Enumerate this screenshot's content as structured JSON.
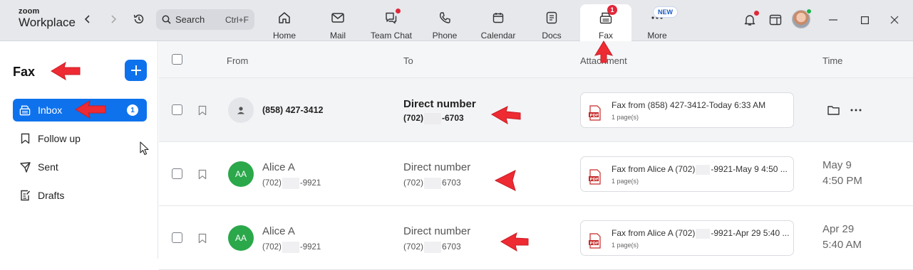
{
  "app": {
    "logo_line1": "zoom",
    "logo_line2": "Workplace"
  },
  "search": {
    "placeholder": "Search",
    "shortcut": "Ctrl+F"
  },
  "tabs": [
    {
      "label": "Home",
      "icon": "home-icon"
    },
    {
      "label": "Mail",
      "icon": "mail-icon"
    },
    {
      "label": "Team Chat",
      "icon": "chat-icon"
    },
    {
      "label": "Phone",
      "icon": "phone-icon"
    },
    {
      "label": "Calendar",
      "icon": "calendar-icon"
    },
    {
      "label": "Docs",
      "icon": "docs-icon"
    },
    {
      "label": "Fax",
      "icon": "fax-icon",
      "badge": "1"
    },
    {
      "label": "More",
      "icon": "more-icon",
      "badge": "NEW"
    }
  ],
  "sidebar": {
    "title": "Fax",
    "items": [
      {
        "label": "Inbox",
        "count": "1",
        "icon": "inbox-icon"
      },
      {
        "label": "Follow up",
        "icon": "bookmark-icon"
      },
      {
        "label": "Sent",
        "icon": "send-icon"
      },
      {
        "label": "Drafts",
        "icon": "drafts-icon"
      }
    ]
  },
  "table": {
    "columns": {
      "from": "From",
      "to": "To",
      "attachment": "Attachment",
      "time": "Time"
    },
    "rows": [
      {
        "from_name": "(858) 427-3412",
        "to_main": "Direct number",
        "to_sub_prefix": "(702)",
        "to_sub_suffix": "-6703",
        "attachment_name": "Fax from (858) 427-3412-Today 6:33 AM",
        "attachment_pages": "1 page(s)"
      },
      {
        "avatar": "AA",
        "from_name": "Alice A",
        "from_sub_prefix": "(702)",
        "from_sub_suffix": "-9921",
        "to_main": "Direct number",
        "to_sub_prefix": "(702)",
        "to_sub_suffix": "6703",
        "attachment_name_prefix": "Fax from Alice A (702)",
        "attachment_name_suffix": "-9921-May 9 4:50 ...",
        "attachment_pages": "1 page(s)",
        "time_line1": "May 9",
        "time_line2": "4:50 PM"
      },
      {
        "avatar": "AA",
        "from_name": "Alice A",
        "from_sub_prefix": "(702)",
        "from_sub_suffix": "-9921",
        "to_main": "Direct number",
        "to_sub_prefix": "(702)",
        "to_sub_suffix": "6703",
        "attachment_name_prefix": "Fax from Alice A (702)",
        "attachment_name_suffix": "-9921-Apr 29 5:40 ...",
        "attachment_pages": "1 page(s)",
        "time_line1": "Apr 29",
        "time_line2": "5:40 AM"
      }
    ]
  },
  "colors": {
    "accent": "#0e72ed",
    "annotation": "#ee2a33",
    "avatar_green": "#2aa84a",
    "badge_red": "#e0283a"
  }
}
